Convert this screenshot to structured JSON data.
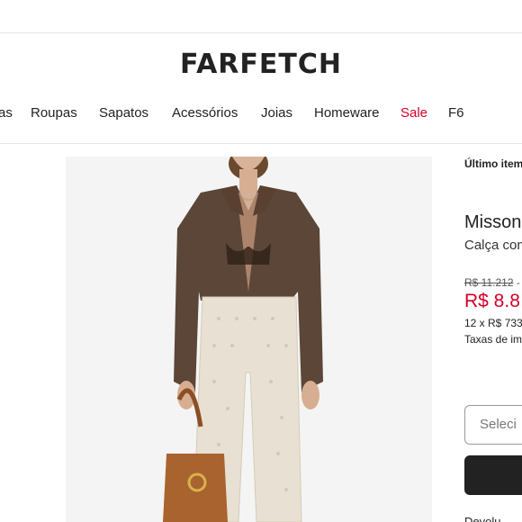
{
  "header": {
    "logo": "FARFETCH"
  },
  "nav": {
    "items": [
      {
        "label": "as"
      },
      {
        "label": "Roupas"
      },
      {
        "label": "Sapatos"
      },
      {
        "label": "Acessórios"
      },
      {
        "label": "Joias"
      },
      {
        "label": "Homeware"
      },
      {
        "label": "Sale"
      },
      {
        "label": "F6"
      }
    ]
  },
  "product": {
    "badge": "Último item",
    "brand": "Missoni",
    "name": "Calça com",
    "old_price": "R$ 11.212",
    "old_price_suffix": " -",
    "price": "R$ 8.8",
    "installments": "12 x R$ 733",
    "taxes": "Taxas de im",
    "size_placeholder": "Seleci",
    "bottom_text": "Devolu"
  },
  "colors": {
    "accent": "#d4002a",
    "text": "#222222",
    "image_bg": "#f4f4f4"
  }
}
